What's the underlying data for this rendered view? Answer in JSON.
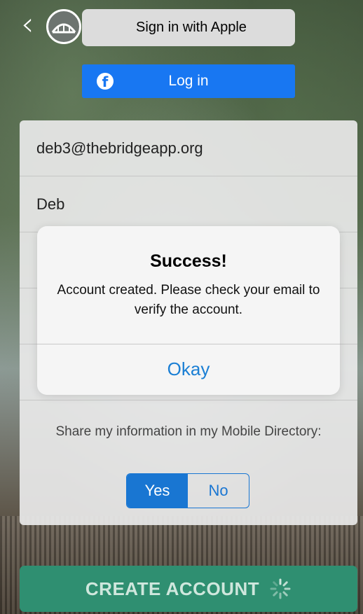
{
  "header": {
    "back_icon": "chevron-left-icon",
    "logo_icon": "bridge-logo-icon",
    "apple_button": {
      "icon": "apple-icon",
      "label": "Sign in with Apple"
    },
    "facebook_button": {
      "icon": "facebook-icon",
      "label": "Log in"
    }
  },
  "form": {
    "email_value": "deb3@thebridgeapp.org",
    "first_name_value": "Deb",
    "share_label": "Share my information in my Mobile Directory:",
    "share_options": [
      "Yes",
      "No"
    ],
    "share_selected": "Yes"
  },
  "alert": {
    "title": "Success!",
    "message": "Account created. Please check your email to verify the account.",
    "button_label": "Okay"
  },
  "footer": {
    "create_button_label": "CREATE ACCOUNT",
    "spinner_icon": "loading-spinner-icon"
  },
  "colors": {
    "facebook_blue": "#1877f2",
    "toggle_blue": "#1976d2",
    "create_green": "#2f8f71",
    "alert_link": "#1b7fd4"
  }
}
